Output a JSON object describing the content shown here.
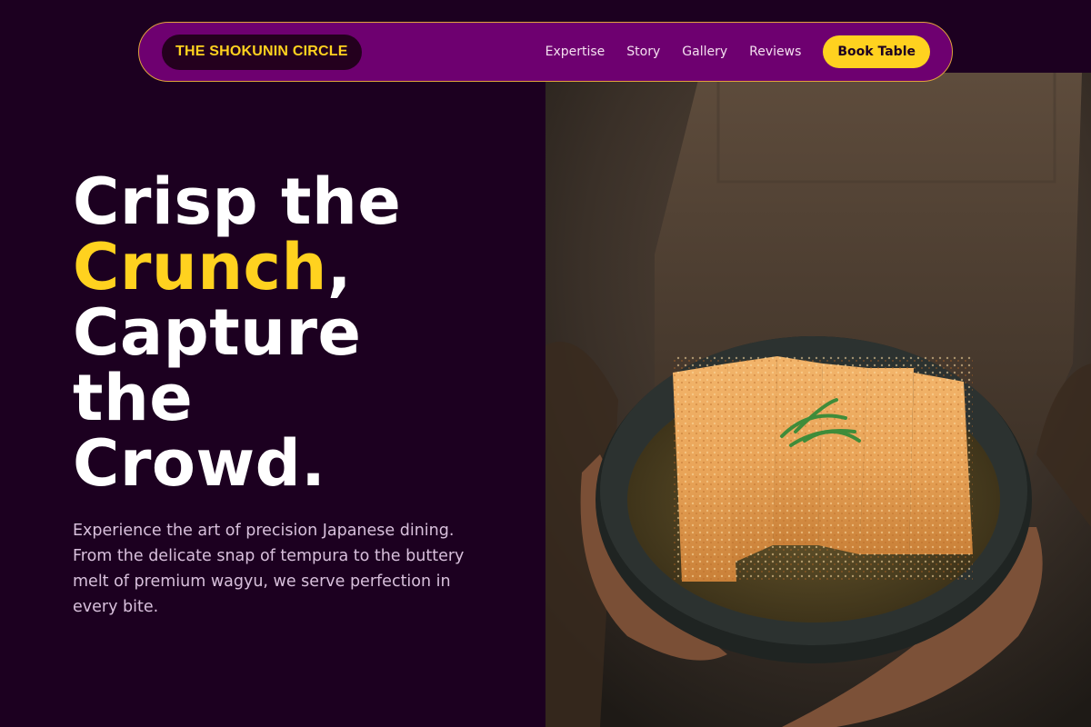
{
  "nav": {
    "brand": "THE SHOKUNIN CIRCLE",
    "links": [
      "Expertise",
      "Story",
      "Gallery",
      "Reviews"
    ],
    "cta": "Book Table"
  },
  "hero": {
    "line1": "Crisp the",
    "accent_word": "Crunch",
    "accent_punct": ",",
    "line3": "Capture",
    "line4": "the",
    "line5": "Crowd.",
    "description": "Experience the art of precision Japanese dining. From the delicate snap of tempura to the buttery melt of premium wagyu, we serve perfection in every bite.",
    "image": "katsu-bowl-photo"
  },
  "colors": {
    "background": "#1c0020",
    "nav_bg": "#6e0070",
    "accent": "#ffd21f",
    "nav_border": "#e0a23c"
  }
}
